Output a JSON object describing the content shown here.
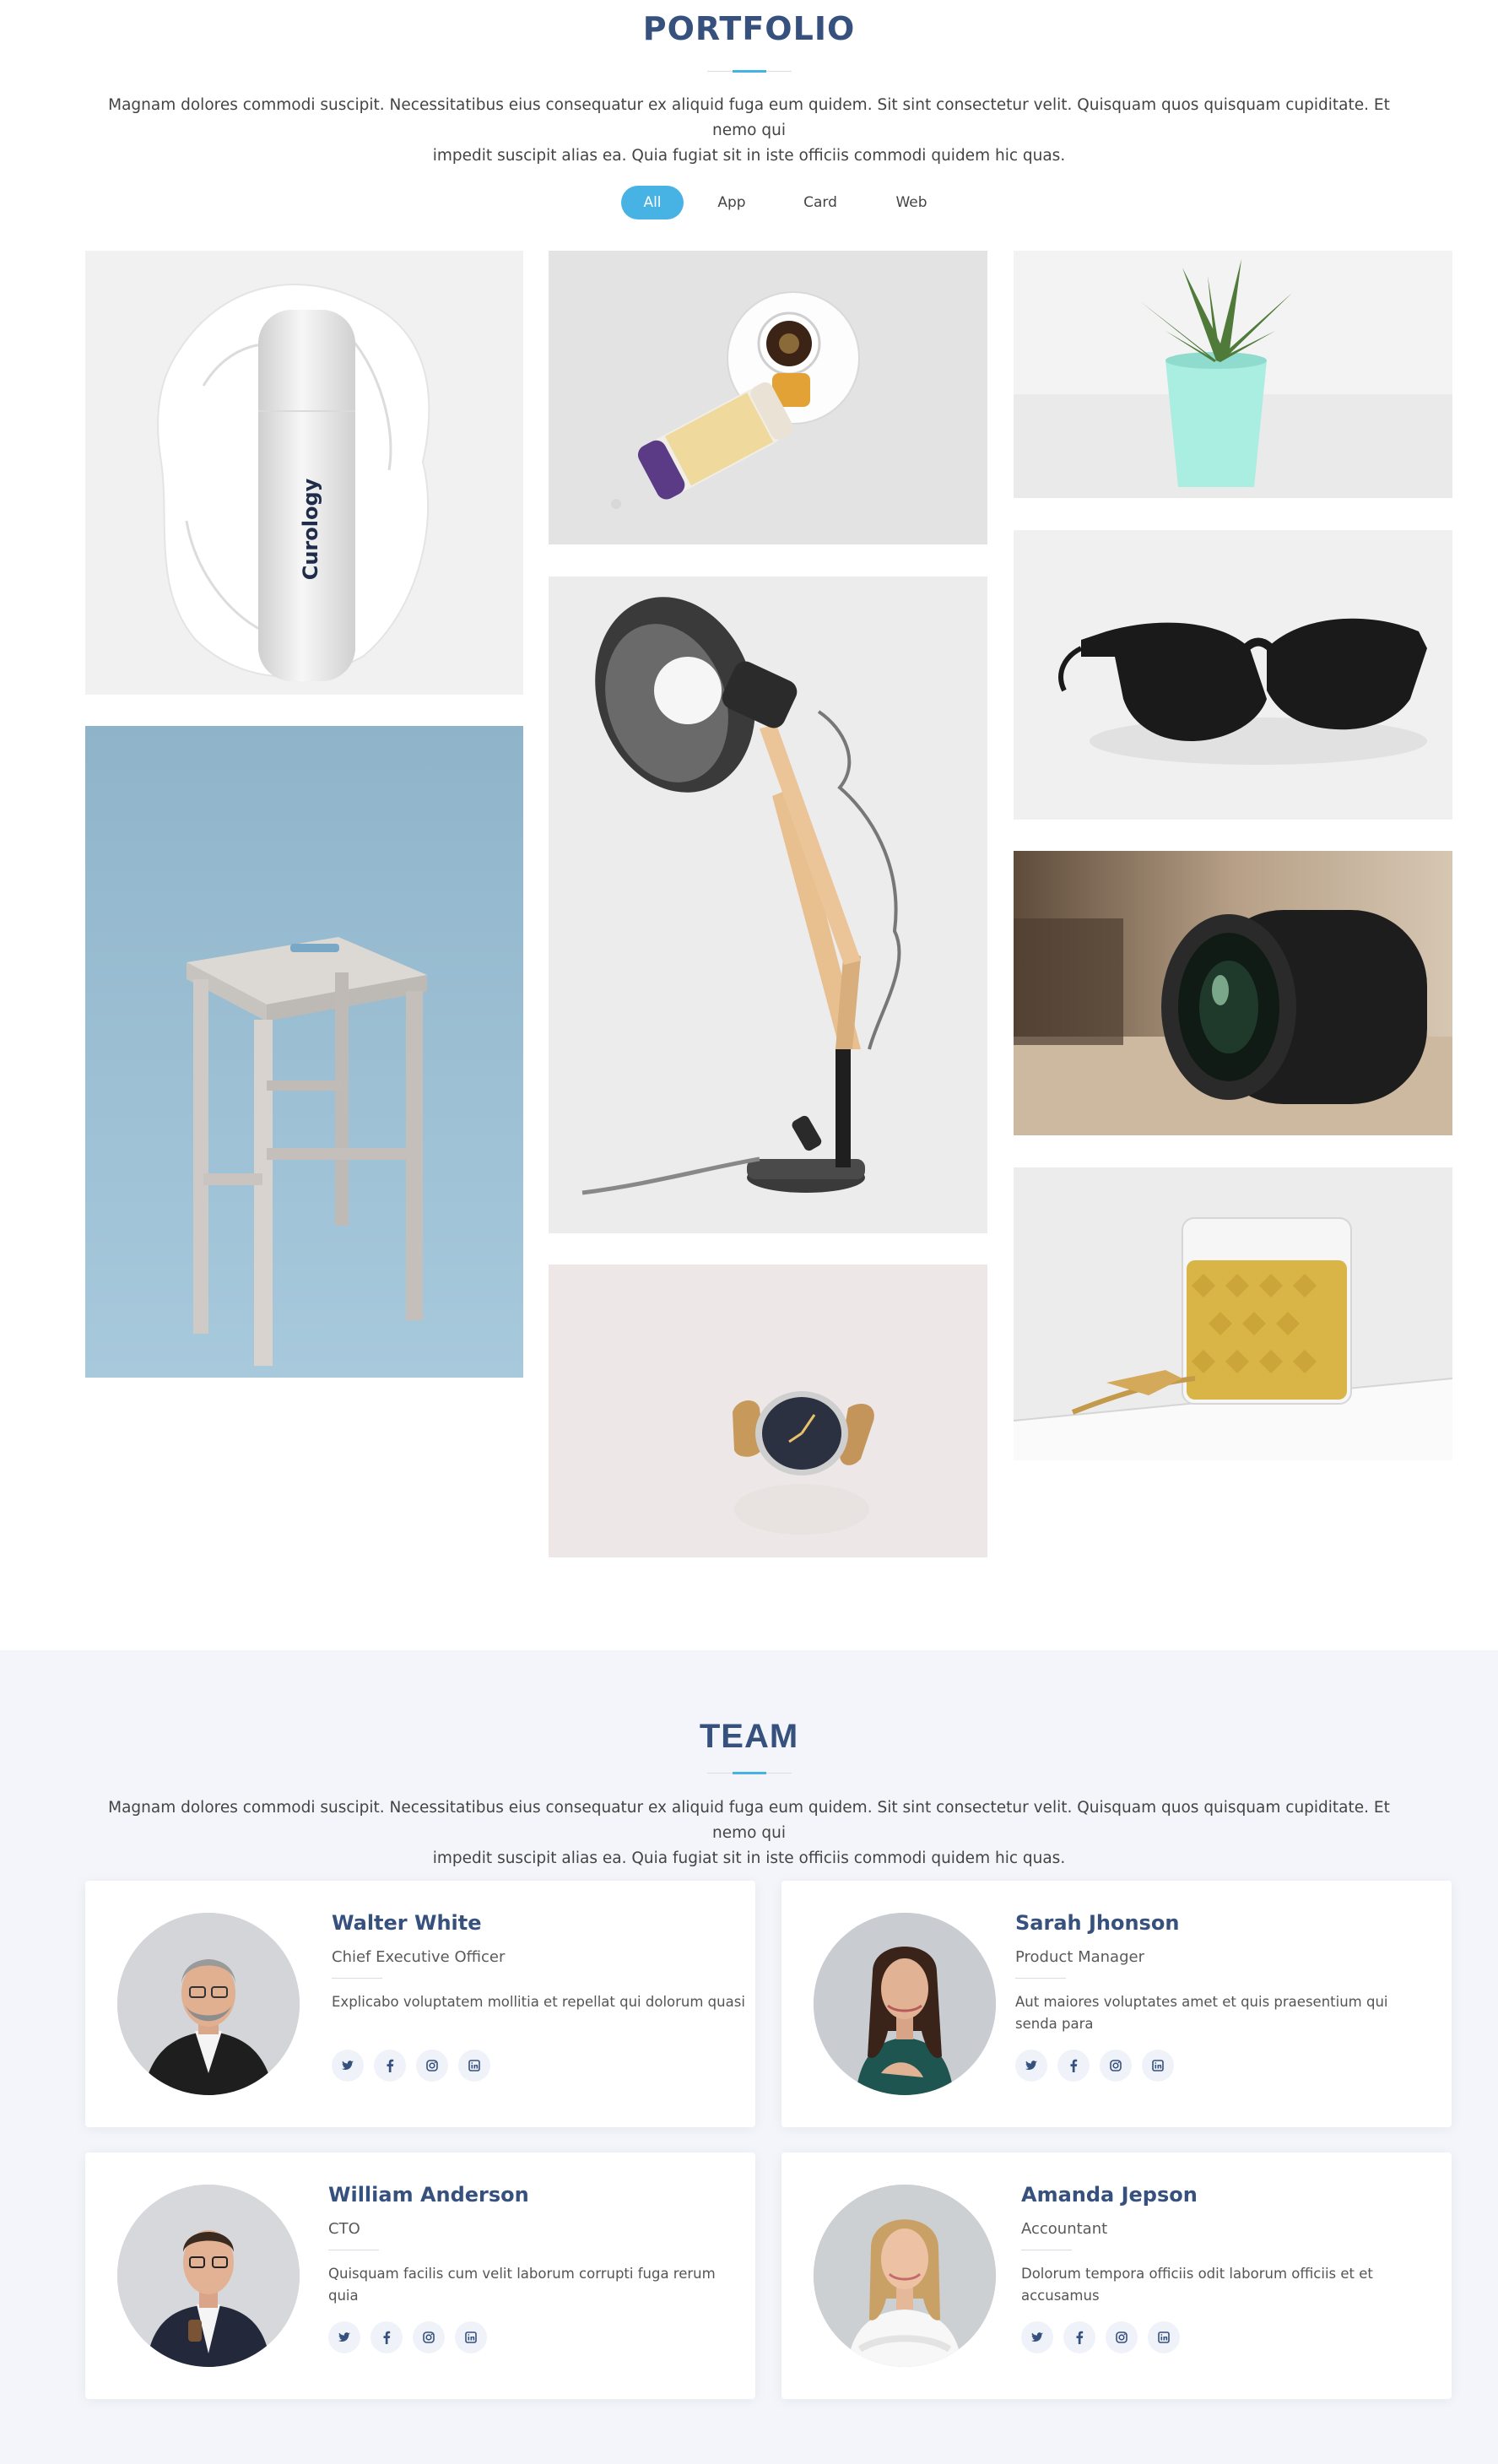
{
  "portfolio": {
    "title": "PORTFOLIO",
    "description_line1": "Magnam dolores commodi suscipit. Necessitatibus eius consequatur ex aliquid fuga eum quidem. Sit sint consectetur velit. Quisquam quos quisquam cupiditate. Et nemo qui",
    "description_line2": "impedit suscipit alias ea. Quia fugiat sit in iste officiis commodi quidem hic quas.",
    "filters": [
      "All",
      "App",
      "Card",
      "Web"
    ],
    "active_filter": "All",
    "items": [
      {
        "name": "skincare-bottle",
        "brand_text": "Curology"
      },
      {
        "name": "tea-and-honey"
      },
      {
        "name": "potted-succulent"
      },
      {
        "name": "sunglasses"
      },
      {
        "name": "wooden-stool"
      },
      {
        "name": "desk-lamp"
      },
      {
        "name": "camera-lens"
      },
      {
        "name": "wristwatch"
      },
      {
        "name": "glass-of-drink"
      }
    ]
  },
  "team": {
    "title": "TEAM",
    "description_line1": "Magnam dolores commodi suscipit. Necessitatibus eius consequatur ex aliquid fuga eum quidem. Sit sint consectetur velit. Quisquam quos quisquam cupiditate. Et nemo qui",
    "description_line2": "impedit suscipit alias ea. Quia fugiat sit in iste officiis commodi quidem hic quas.",
    "members": [
      {
        "name": "Walter White",
        "role": "Chief Executive Officer",
        "bio": "Explicabo voluptatem mollitia et repellat qui dolorum quasi"
      },
      {
        "name": "Sarah Jhonson",
        "role": "Product Manager",
        "bio": "Aut maiores voluptates amet et quis praesentium qui senda para"
      },
      {
        "name": "William Anderson",
        "role": "CTO",
        "bio": "Quisquam facilis cum velit laborum corrupti fuga rerum quia"
      },
      {
        "name": "Amanda Jepson",
        "role": "Accountant",
        "bio": "Dolorum tempora officiis odit laborum officiis et et accusamus"
      }
    ],
    "social_icons": [
      "twitter-icon",
      "facebook-icon",
      "instagram-icon",
      "linkedin-icon"
    ]
  },
  "colors": {
    "heading": "#37517e",
    "accent": "#47b2e4",
    "team_background": "#f3f5fa"
  }
}
